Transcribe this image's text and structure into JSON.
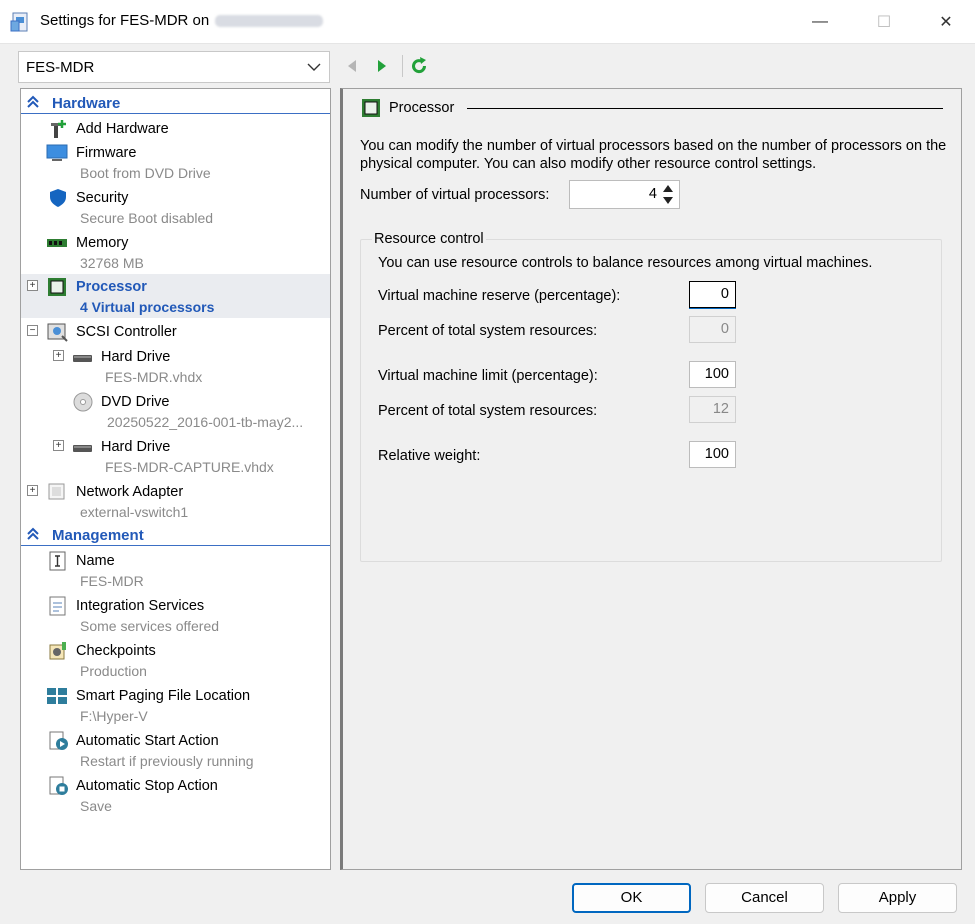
{
  "window": {
    "title": "Settings for FES-MDR on",
    "minimize_glyph": "—",
    "maximize_glyph": "☐",
    "close_glyph": "✕"
  },
  "vm_selector": {
    "value": "FES-MDR"
  },
  "tree": {
    "hardware_header": "Hardware",
    "management_header": "Management",
    "hardware_items": [
      {
        "label": "Add Hardware",
        "sub": "",
        "icon": "add-hardware-icon"
      },
      {
        "label": "Firmware",
        "sub": "Boot from DVD Drive",
        "icon": "firmware-icon"
      },
      {
        "label": "Security",
        "sub": "Secure Boot disabled",
        "icon": "shield-icon"
      },
      {
        "label": "Memory",
        "sub": "32768 MB",
        "icon": "memory-icon"
      },
      {
        "label": "Processor",
        "sub": "4 Virtual processors",
        "icon": "processor-icon",
        "selected": true
      },
      {
        "label": "SCSI Controller",
        "sub": "",
        "icon": "scsi-controller-icon"
      },
      {
        "label": "Hard Drive",
        "sub": "FES-MDR.vhdx",
        "icon": "hard-drive-icon"
      },
      {
        "label": "DVD Drive",
        "sub": "20250522_2016-001-tb-may2...",
        "icon": "dvd-icon"
      },
      {
        "label": "Hard Drive",
        "sub": "FES-MDR-CAPTURE.vhdx",
        "icon": "hard-drive-icon"
      },
      {
        "label": "Network Adapter",
        "sub": "external-vswitch1",
        "icon": "network-adapter-icon"
      }
    ],
    "management_items": [
      {
        "label": "Name",
        "sub": "FES-MDR",
        "icon": "name-icon"
      },
      {
        "label": "Integration Services",
        "sub": "Some services offered",
        "icon": "integration-services-icon"
      },
      {
        "label": "Checkpoints",
        "sub": "Production",
        "icon": "checkpoints-icon"
      },
      {
        "label": "Smart Paging File Location",
        "sub": "F:\\Hyper-V",
        "icon": "smart-paging-icon"
      },
      {
        "label": "Automatic Start Action",
        "sub": "Restart if previously running",
        "icon": "auto-start-icon"
      },
      {
        "label": "Automatic Stop Action",
        "sub": "Save",
        "icon": "auto-stop-icon"
      }
    ]
  },
  "processor_panel": {
    "title": "Processor",
    "description": "You can modify the number of virtual processors based on the number of processors on the physical computer. You can also modify other resource control settings.",
    "num_vp_label": "Number of virtual processors:",
    "num_vp_value": "4",
    "resource_control": {
      "title": "Resource control",
      "description": "You can use resource controls to balance resources among virtual machines.",
      "reserve_label": "Virtual machine reserve (percentage):",
      "reserve_value": "0",
      "reserve_pct_label": "Percent of total system resources:",
      "reserve_pct_value": "0",
      "limit_label": "Virtual machine limit (percentage):",
      "limit_value": "100",
      "limit_pct_label": "Percent of total system resources:",
      "limit_pct_value": "12",
      "weight_label": "Relative weight:",
      "weight_value": "100"
    }
  },
  "buttons": {
    "ok": "OK",
    "cancel": "Cancel",
    "apply": "Apply"
  },
  "colors": {
    "accent": "#2259b8",
    "focus": "#0067c0",
    "nav_green": "#22a13a"
  }
}
